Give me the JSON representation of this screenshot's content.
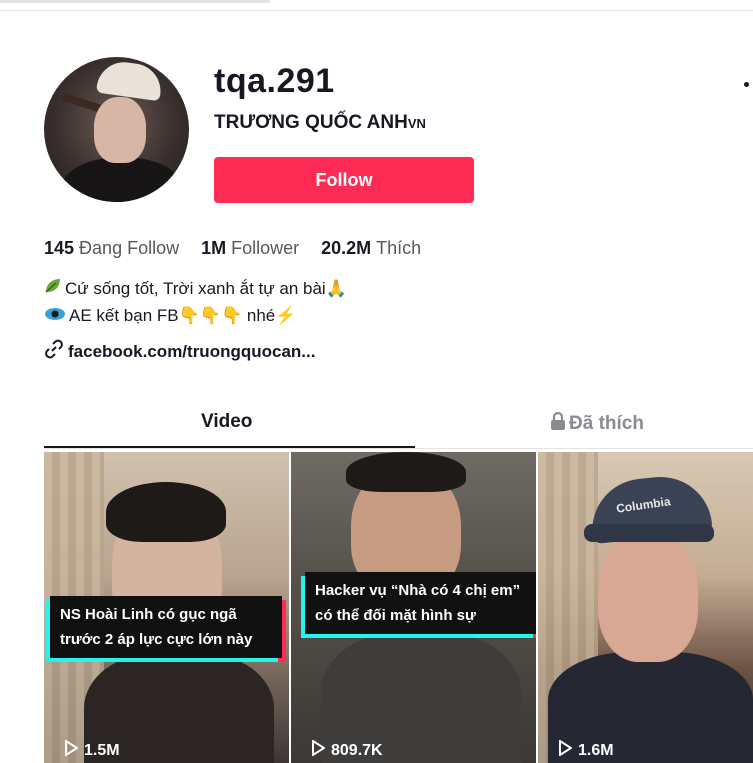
{
  "profile": {
    "username": "tqa.291",
    "nickname_main": "TRƯƠNG QUỐC ANH",
    "nickname_suffix": "VN",
    "follow_label": "Follow"
  },
  "stats": {
    "following_count": "145",
    "following_label": "Đang Follow",
    "followers_count": "1M",
    "followers_label": "Follower",
    "likes_count": "20.2M",
    "likes_label": "Thích"
  },
  "bio": {
    "line1_text": "Cứ sống tốt, Trời xanh ắt tự an bài",
    "line1_end_emoji": "🙏",
    "line2_text": "AE kết bạn FB",
    "line2_pointers": "👇👇👇",
    "line2_end": " nhé",
    "line2_end_emoji": "⚡"
  },
  "link": {
    "text": "facebook.com/truongquocan..."
  },
  "tabs": {
    "video": "Video",
    "liked": "Đã thích"
  },
  "videos": [
    {
      "caption": "NS Hoài Linh có gục ngã trước 2 áp lực cực lớn này",
      "views": "1.5M"
    },
    {
      "caption": "Hacker vụ “Nhà có 4 chị em” có thể đối mặt hình sự",
      "views": "809.7K"
    },
    {
      "caption": "",
      "views": "1.6M",
      "cap_logo": "Columbia"
    }
  ],
  "colors": {
    "accent": "#fe2c55",
    "cyan": "#25f4ee",
    "text": "#161823",
    "muted": "#57585e"
  },
  "icons": [
    "more-icon",
    "link-icon",
    "lock-icon",
    "play-icon",
    "leaf-icon",
    "eye-icon"
  ]
}
